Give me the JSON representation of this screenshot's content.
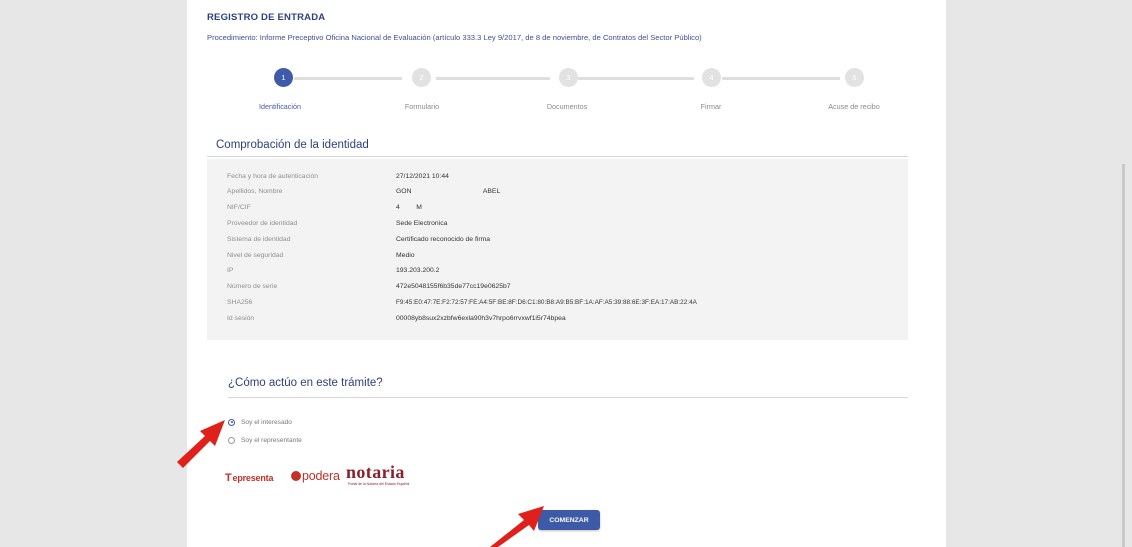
{
  "header": {
    "title": "REGISTRO DE ENTRADA",
    "procedure": "Procedimiento: Informe Preceptivo Oficina Nacional de Evaluación (artículo 333.3 Ley 9/2017, de 8 de noviembre, de Contratos del Sector Público)"
  },
  "stepper": {
    "steps": [
      {
        "number": "1",
        "label": "Identificación",
        "active": true
      },
      {
        "number": "2",
        "label": "Formulario",
        "active": false
      },
      {
        "number": "3",
        "label": "Documentos",
        "active": false
      },
      {
        "number": "4",
        "label": "Firmar",
        "active": false
      },
      {
        "number": "5",
        "label": "Acuse de recibo",
        "active": false
      }
    ]
  },
  "identity": {
    "title": "Comprobación de la identidad",
    "rows": [
      {
        "label": "Fecha y hora de autenticación",
        "value": "27/12/2021 10:44"
      },
      {
        "label": "Apellidos, Nombre",
        "value": "GON                                      ABEL"
      },
      {
        "label": "NIF/CIF",
        "value": "4         M"
      },
      {
        "label": "Proveedor de identidad",
        "value": "Sede Electronica"
      },
      {
        "label": "Sistema de identidad",
        "value": "Certificado reconocido de firma"
      },
      {
        "label": "Nivel de seguridad",
        "value": "Medio"
      },
      {
        "label": "IP",
        "value": "193.203.200.2"
      },
      {
        "label": "Número de serie",
        "value": "472e5048155f6b35de77cc19e0625b7"
      },
      {
        "label": "SHA256",
        "value": "F9:45:E0:47:7E:F2:72:57:FE:A4:5F:BE:8F:D6:C1:80:B8:A9:B5:BF:1A:AF:A5:39:88:6E:3F:EA:17:AB:22:4A"
      },
      {
        "label": "Id sesión",
        "value": "00008yb8sux2xzbfw6exla90h3v7hrpo6rrvxwf1i5r74bpea"
      }
    ]
  },
  "role": {
    "title": "¿Cómo actúo en este trámite?",
    "options": [
      {
        "label": "Soy el interesado",
        "checked": true
      },
      {
        "label": "Soy el representante",
        "checked": false
      }
    ]
  },
  "logos": {
    "representa": "epresenta",
    "apodera": "podera",
    "notaria": "notaria",
    "notaria_sub": "Portal de la Notaría del Estado Español"
  },
  "actions": {
    "start_label": "COMENZAR"
  },
  "colors": {
    "primary": "#3f5aa8",
    "heading": "#2e3f7f",
    "arrow": "#e0201b",
    "logo_red": "#c0322b"
  }
}
